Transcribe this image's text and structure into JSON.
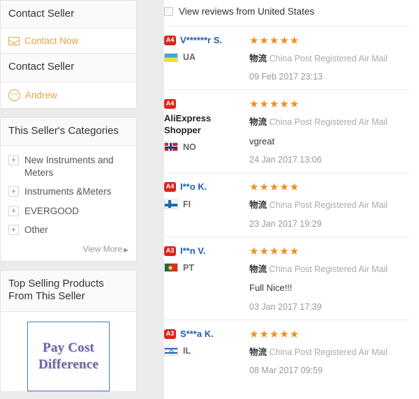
{
  "sidebar": {
    "contact_panel": {
      "title": "Contact Seller",
      "action_label": "Contact Now",
      "action_icon": "envelope-icon"
    },
    "seller_panel": {
      "title": "Contact Seller",
      "seller_name": "Andrew",
      "seller_icon": "avatar-icon"
    },
    "categories_panel": {
      "title": "This Seller's Categories",
      "items": [
        {
          "label": "New Instruments and Meters",
          "expander": "+"
        },
        {
          "label": "Instruments &Meters",
          "expander": "+"
        },
        {
          "label": "EVERGOOD",
          "expander": "+"
        },
        {
          "label": "Other",
          "expander": "+"
        }
      ],
      "view_more_label": "View More",
      "view_more_arrow": "▶"
    },
    "top_selling_panel": {
      "title": "Top Selling Products From This Seller",
      "product": {
        "title_line1": "Pay Cost",
        "title_line2": "Difference",
        "border_color": "#3d7ebd",
        "text_color": "#6a6aa8"
      }
    }
  },
  "reviews_section": {
    "filter": {
      "checkbox_label": "View reviews from United States",
      "checked": false
    },
    "logistics_prefix": "物流",
    "stars_glyph": "★★★★★",
    "items": [
      {
        "level": "A4",
        "name": "V******r S.",
        "name_is_link": true,
        "country_code": "UA",
        "flag": "flag-ua",
        "rating": 5,
        "logistics": "China Post Registered Air Mail",
        "comment": "",
        "date": "09 Feb 2017 23:13"
      },
      {
        "level": "A4",
        "name": "AliExpress Shopper",
        "name_is_link": false,
        "country_code": "NO",
        "flag": "flag-no",
        "rating": 5,
        "logistics": "China Post Registered Air Mail",
        "comment": "vgreat",
        "date": "24 Jan 2017 13:06"
      },
      {
        "level": "A4",
        "name": "I**o K.",
        "name_is_link": true,
        "country_code": "FI",
        "flag": "flag-fi",
        "rating": 5,
        "logistics": "China Post Registered Air Mail",
        "comment": "",
        "date": "23 Jan 2017 19:29"
      },
      {
        "level": "A3",
        "name": "I**n V.",
        "name_is_link": true,
        "country_code": "PT",
        "flag": "flag-pt",
        "rating": 5,
        "logistics": "China Post Registered Air Mail",
        "comment": "Full Nice!!!",
        "date": "03 Jan 2017 17:39"
      },
      {
        "level": "A3",
        "name": "S***a K.",
        "name_is_link": true,
        "country_code": "IL",
        "flag": "flag-il",
        "rating": 5,
        "logistics": "China Post Registered Air Mail",
        "comment": "",
        "date": "08 Mar 2017 09:59"
      }
    ]
  },
  "colors": {
    "badge_red": "#d9261c",
    "link_blue": "#1f5fb5",
    "star_orange": "#f18e1b",
    "accent_orange": "#e8a33d",
    "page_bg": "#ebebeb"
  }
}
